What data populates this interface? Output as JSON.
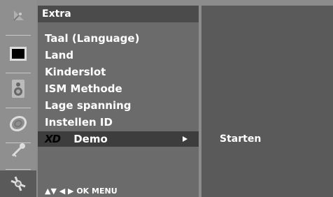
{
  "sidebar": {
    "icons": [
      {
        "name": "satellite-dish-icon"
      },
      {
        "name": "picture-icon"
      },
      {
        "name": "speaker-icon"
      },
      {
        "name": "clock-icon"
      },
      {
        "name": "key-icon"
      },
      {
        "name": "gear-icon",
        "active": true
      }
    ]
  },
  "menu": {
    "title": "Extra",
    "items": [
      {
        "label": "Taal (Language)"
      },
      {
        "label": "Land"
      },
      {
        "label": "Kinderslot"
      },
      {
        "label": "ISM Methode"
      },
      {
        "label": "Lage spanning"
      },
      {
        "label": "Instellen ID"
      },
      {
        "logo": "XD",
        "label": "Demo",
        "selected": true
      }
    ],
    "nav_hint": "▲▼ ◀ ▶ OK MENU"
  },
  "submenu": {
    "option": "Starten"
  },
  "colors": {
    "background": "#8c8c8c",
    "menu_bg": "#6b6b6b",
    "title_bg": "#4b4b4b",
    "selected_bg": "#3d3d3d",
    "panel_bg": "#5a5a5a",
    "text": "#ffffff"
  }
}
